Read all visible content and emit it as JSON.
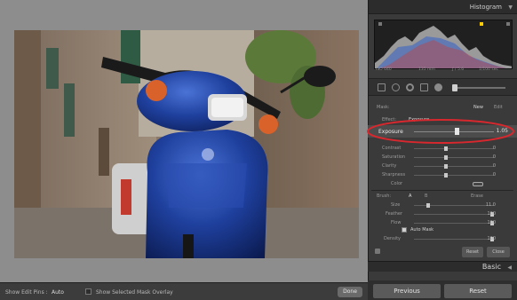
{
  "histogram": {
    "title": "Histogram",
    "info": {
      "iso": "ISO 640",
      "focal": "135 mm",
      "aperture": "ƒ / 5.6",
      "shutter": "1/100 sec"
    }
  },
  "mask": {
    "label": "Mask:",
    "new_label": "New",
    "edit_label": "Edit"
  },
  "effect": {
    "label": "Effect:",
    "value": "Exposure"
  },
  "sliders": [
    {
      "name": "Exposure",
      "value": "1.05",
      "pos": 0.56
    },
    {
      "name": "Contrast",
      "value": "0",
      "pos": 0.5
    },
    {
      "name": "Saturation",
      "value": "0",
      "pos": 0.5
    },
    {
      "name": "Clarity",
      "value": "0",
      "pos": 0.5
    },
    {
      "name": "Sharpness",
      "value": "0",
      "pos": 0.5
    },
    {
      "name": "Color",
      "value": "",
      "pos": null
    }
  ],
  "brush": {
    "label": "Brush:",
    "a_label": "A",
    "b_label": "B",
    "erase_label": "Erase",
    "settings": [
      {
        "name": "Size",
        "value": "11.0",
        "pos": 0.18
      },
      {
        "name": "Feather",
        "value": "100",
        "pos": 1.0
      },
      {
        "name": "Flow",
        "value": "100",
        "pos": 1.0
      },
      {
        "name": "Density",
        "value": "100",
        "pos": 1.0
      }
    ],
    "auto_mask_label": "Auto Mask",
    "auto_mask_checked": true
  },
  "panel_buttons": {
    "reset": "Reset",
    "close": "Close"
  },
  "basic": {
    "title": "Basic"
  },
  "footer": {
    "previous": "Previous",
    "reset": "Reset"
  },
  "bottom_bar": {
    "show_pins_label": "Show Edit Pins :",
    "show_pins_value": "Auto",
    "overlay_label": "Show Selected Mask Overlay",
    "done_label": "Done"
  },
  "colors": {
    "highlight_ellipse": "#d8282e",
    "scooter_blue": "#1e3f9c",
    "panel_bg": "#3a3a3a"
  }
}
